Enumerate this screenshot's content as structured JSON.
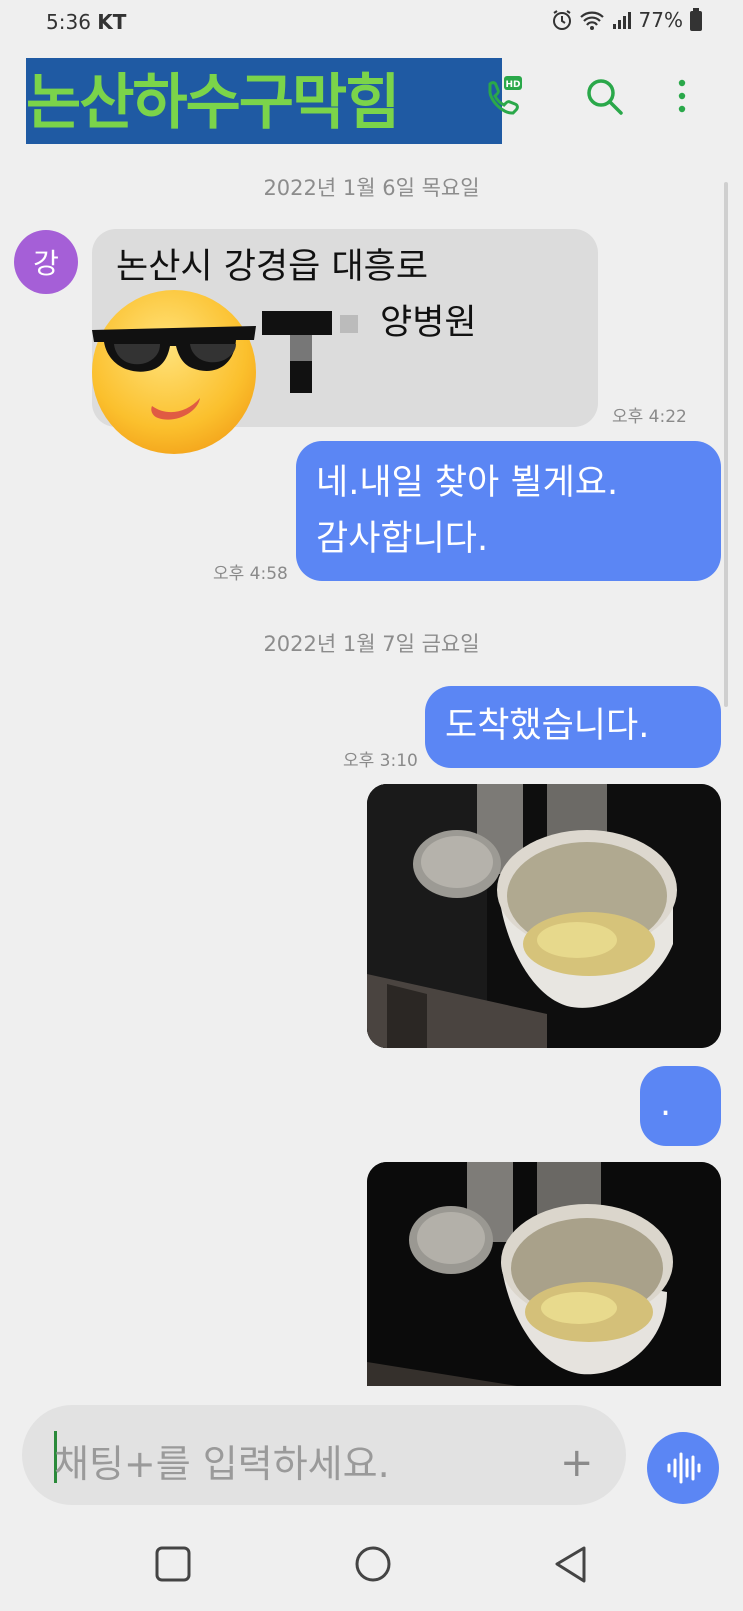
{
  "status_bar": {
    "time": "5:36",
    "carrier": "KT",
    "battery": "77%"
  },
  "header": {
    "title": "논산하수구막힘",
    "icons": [
      "hd-call-icon",
      "search-icon",
      "more-vert-icon"
    ]
  },
  "conversation": {
    "day1": "2022년 1월 6일 목요일",
    "avatar_initial": "강",
    "incoming": {
      "line1": "논산시 강경읍 대흥로",
      "line2": "양병원",
      "time": "오후 4:22"
    },
    "outgoing1": {
      "line1": "네.내일 찾아 뵐게요.",
      "line2": "감사합니다.",
      "time": "오후 4:58"
    },
    "day2": "2022년 1월 7일 금요일",
    "outgoing2": {
      "text": "도착했습니다.",
      "time": "오후 3:10"
    },
    "outgoing3": {
      "text": "."
    }
  },
  "input_bar": {
    "placeholder": "채팅+를 입력하세요.",
    "plus": "+"
  },
  "colors": {
    "accent": "#5b86f4",
    "header_green": "#2aa84a",
    "title_bg": "#1f5aa3",
    "title_text": "#7bd44a"
  }
}
